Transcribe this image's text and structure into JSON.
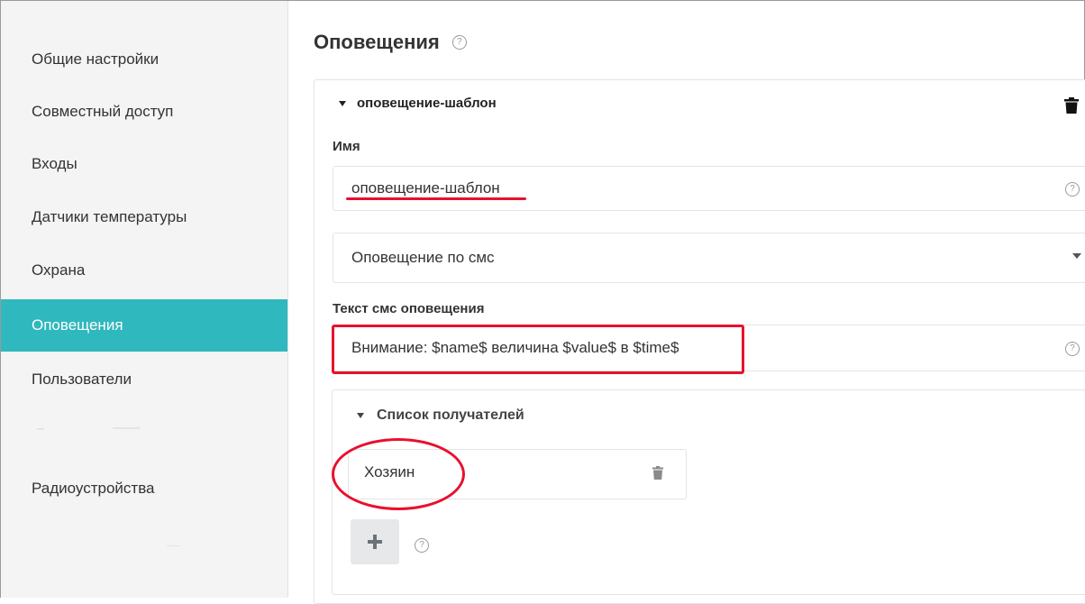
{
  "sidebar": {
    "items": [
      {
        "label": "Общие настройки",
        "active": false
      },
      {
        "label": "Совместный доступ",
        "active": false
      },
      {
        "label": "Входы",
        "active": false
      },
      {
        "label": "Датчики температуры",
        "active": false
      },
      {
        "label": "Охрана",
        "active": false
      },
      {
        "label": "Оповещения",
        "active": true
      },
      {
        "label": "Пользователи",
        "active": false
      },
      {
        "label": "Радиоустройства",
        "active": false
      }
    ],
    "active_color": "#2fb8bd"
  },
  "main": {
    "title": "Оповещения",
    "help_glyph": "?",
    "alert": {
      "header": "оповещение-шаблон",
      "name_label": "Имя",
      "name_value": "оповещение-шаблон",
      "type_value": "Оповещение по смс",
      "sms_label": "Текст смс оповещения",
      "sms_value": "Внимание: $name$ величина $value$ в $time$",
      "recipients": {
        "header": "Список получателей",
        "items": [
          "Хозяин"
        ],
        "add_glyph": "+"
      }
    }
  },
  "annotation_color": "#e8112d"
}
